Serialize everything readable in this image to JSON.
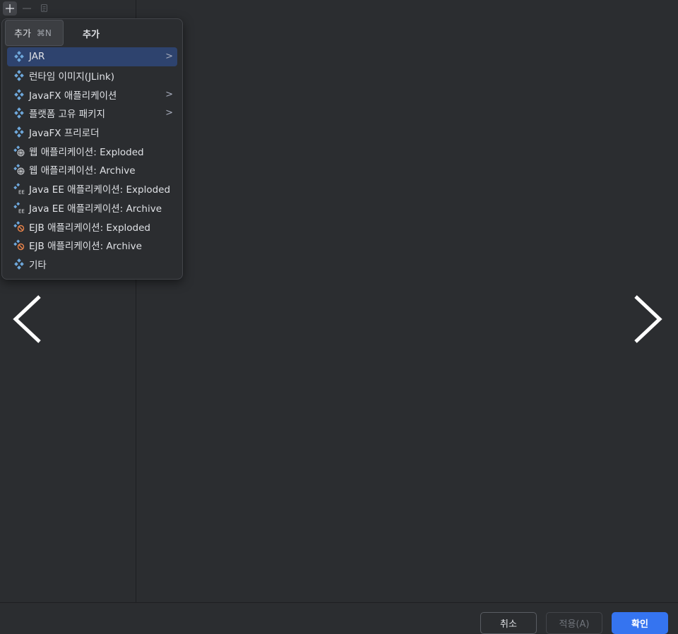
{
  "tooltip": {
    "label": "추가",
    "shortcut": "⌘N"
  },
  "popup": {
    "title": "추가",
    "items": [
      {
        "label": "JAR",
        "icon": "artifact-icon",
        "submenu": true,
        "selected": true
      },
      {
        "label": "런타임 이미지(JLink)",
        "icon": "artifact-icon",
        "submenu": false
      },
      {
        "label": "JavaFX 애플리케이션",
        "icon": "artifact-icon",
        "submenu": true
      },
      {
        "label": "플랫폼 고유 패키지",
        "icon": "artifact-icon",
        "submenu": true
      },
      {
        "label": "JavaFX 프리로더",
        "icon": "artifact-icon",
        "submenu": false
      },
      {
        "label": "웹 애플리케이션: Exploded",
        "icon": "web-artifact-icon",
        "submenu": false
      },
      {
        "label": "웹 애플리케이션: Archive",
        "icon": "web-artifact-icon",
        "submenu": false
      },
      {
        "label": "Java EE 애플리케이션: Exploded",
        "icon": "javaee-artifact-icon",
        "submenu": false
      },
      {
        "label": "Java EE 애플리케이션: Archive",
        "icon": "javaee-artifact-icon",
        "submenu": false
      },
      {
        "label": "EJB 애플리케이션: Exploded",
        "icon": "ejb-artifact-icon",
        "submenu": false
      },
      {
        "label": "EJB 애플리케이션: Archive",
        "icon": "ejb-artifact-icon",
        "submenu": false
      },
      {
        "label": "기타",
        "icon": "artifact-icon",
        "submenu": false
      }
    ],
    "submenu_arrow": ">"
  },
  "buttons": {
    "cancel": "취소",
    "apply": "적용(A)",
    "ok": "확인"
  },
  "colors": {
    "accent": "#3574f0",
    "selection": "#2e436e",
    "background": "#2b2d30"
  }
}
